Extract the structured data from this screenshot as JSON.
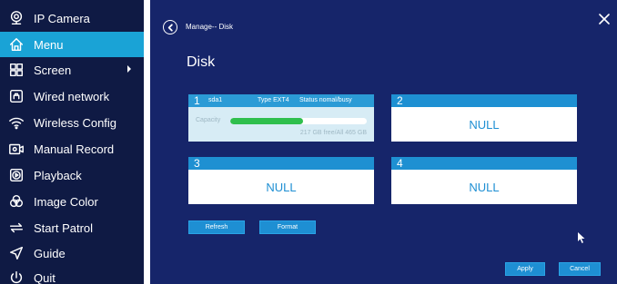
{
  "sidebar": {
    "items": [
      {
        "label": "IP Camera",
        "icon": "ip-camera-icon",
        "active": false
      },
      {
        "label": "Menu",
        "icon": "home-icon",
        "active": true
      },
      {
        "label": "Screen",
        "icon": "grid-icon",
        "active": false,
        "has_submenu": true
      },
      {
        "label": "Wired network",
        "icon": "wired-network-icon",
        "active": false
      },
      {
        "label": "Wireless Config",
        "icon": "wifi-icon",
        "active": false
      },
      {
        "label": "Manual Record",
        "icon": "record-icon",
        "active": false
      },
      {
        "label": "Playback",
        "icon": "playback-icon",
        "active": false
      },
      {
        "label": "Image Color",
        "icon": "color-icon",
        "active": false
      },
      {
        "label": "Start Patrol",
        "icon": "patrol-icon",
        "active": false
      },
      {
        "label": "Guide",
        "icon": "guide-icon",
        "active": false
      },
      {
        "label": "Quit",
        "icon": "power-icon",
        "active": false
      }
    ]
  },
  "header": {
    "breadcrumb": "Manage-- Disk",
    "title": "Disk"
  },
  "disks": {
    "d1": {
      "number": "1",
      "name": "sda1",
      "type": "Type EXT4",
      "status": "Status  nomal/busy",
      "capacity_label": "Capacity",
      "capacity_used_fraction": 0.53,
      "capacity_text": "217 GB free/All 465 GB"
    },
    "d2": {
      "number": "2",
      "value": "NULL"
    },
    "d3": {
      "number": "3",
      "value": "NULL"
    },
    "d4": {
      "number": "4",
      "value": "NULL"
    }
  },
  "actions": {
    "refresh": "Refresh",
    "format": "Format",
    "apply": "Apply",
    "cancel": "Cancel"
  },
  "colors": {
    "sidebar_bg": "#0f1a44",
    "active_item": "#1aa3d6",
    "panel_bg": "#16256a",
    "card_header": "#1e90d2",
    "capacity_fill": "#2fbf4d"
  }
}
